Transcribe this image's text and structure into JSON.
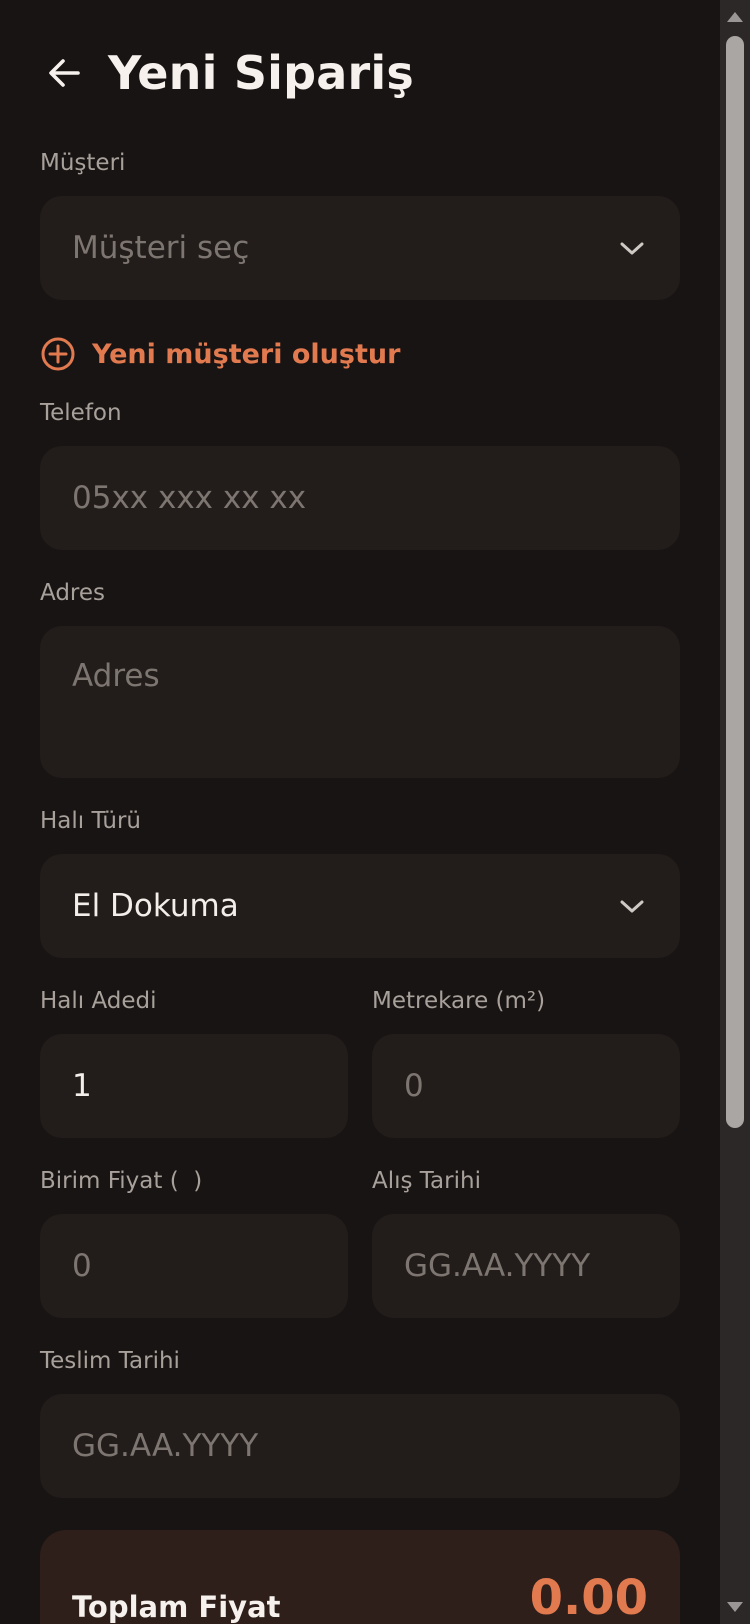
{
  "header": {
    "title": "Yeni Sipariş"
  },
  "customer": {
    "label": "Müşteri",
    "placeholder": "Müşteri seç"
  },
  "new_customer": {
    "label": "Yeni müşteri oluştur"
  },
  "phone": {
    "label": "Telefon",
    "placeholder": "05xx xxx xx xx"
  },
  "address": {
    "label": "Adres",
    "placeholder": "Adres"
  },
  "carpet_type": {
    "label": "Halı Türü",
    "value": "El Dokuma"
  },
  "carpet_count": {
    "label": "Halı Adedi",
    "value": "1"
  },
  "area": {
    "label": "Metrekare (m²)",
    "placeholder": "0"
  },
  "unit_price": {
    "label": "Birim Fiyat (  )",
    "placeholder": "0"
  },
  "pickup_date": {
    "label": "Alış Tarihi",
    "placeholder": "GG.AA.YYYY"
  },
  "delivery_date": {
    "label": "Teslim Tarihi",
    "placeholder": "GG.AA.YYYY"
  },
  "total": {
    "label": "Toplam Fiyat",
    "value": "0.00"
  },
  "colors": {
    "accent": "#e27a50",
    "background": "#181413",
    "field": "#221d1b",
    "total_card": "#2e1f1a"
  },
  "icons": {
    "back": "arrow-left-icon",
    "dropdown": "chevron-down-icon",
    "add": "plus-circle-icon"
  }
}
